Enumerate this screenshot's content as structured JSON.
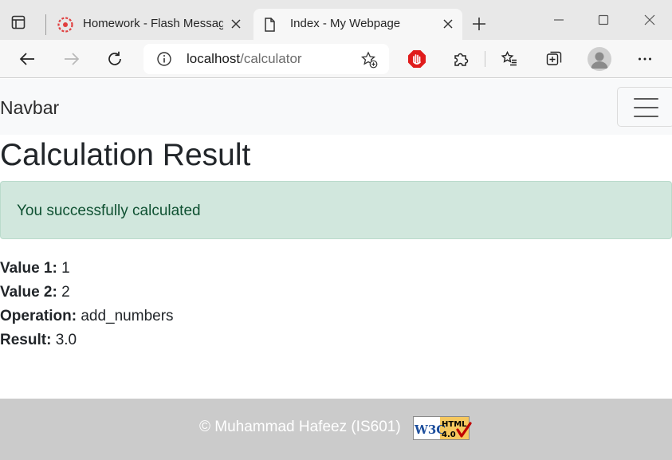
{
  "browser": {
    "tabs": [
      {
        "title": "Homework - Flash Messages",
        "active": false
      },
      {
        "title": "Index - My Webpage",
        "active": true
      }
    ],
    "address_bar": {
      "host": "localhost",
      "path": "/calculator"
    }
  },
  "page": {
    "navbar": {
      "brand": "Navbar"
    },
    "title": "Calculation Result",
    "alert": {
      "message": "You successfully calculated",
      "color": "#d1e7dd"
    },
    "results": [
      {
        "label": "Value 1:",
        "value": "1"
      },
      {
        "label": "Value 2:",
        "value": "2"
      },
      {
        "label": "Operation:",
        "value": "add_numbers"
      },
      {
        "label": "Result:",
        "value": "3.0"
      }
    ],
    "footer": {
      "text": "© Muhammad Hafeez (IS601)",
      "badge": {
        "w3c_text": "W3C",
        "html_text": "HTML",
        "version_text": "4.0"
      }
    }
  }
}
